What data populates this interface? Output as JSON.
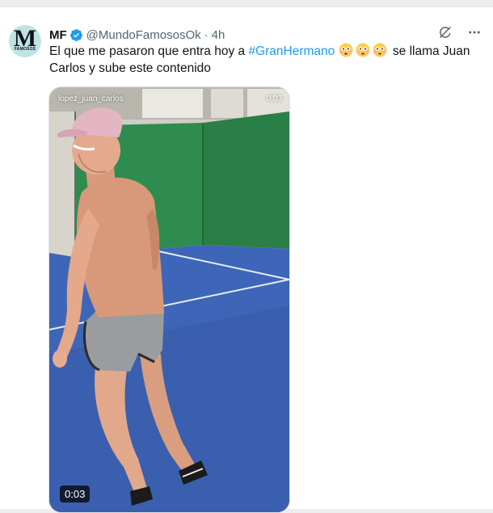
{
  "post": {
    "avatar_letter": "M",
    "avatar_sub": "FAMOSOS",
    "display_name": "MF",
    "handle": "@MundoFamososOk",
    "separator": "·",
    "time": "4h",
    "text_before": "El que me pasaron que entra hoy a ",
    "hashtag": "#GranHermano",
    "text_after": " se llama Juan Carlos y sube este contenido",
    "emoji_count": 3,
    "emoji_name": "flushed-face",
    "verified_color": "#1d9bf0"
  },
  "media": {
    "overlay_username": "lopez_juan_carlos",
    "overlay_time": "0:03",
    "duration_badge": "0:03",
    "court_color": "#3e66b8",
    "wall_color": "#2f8c4f"
  },
  "icons": {
    "grok": "grok-icon",
    "more": "more-icon"
  }
}
